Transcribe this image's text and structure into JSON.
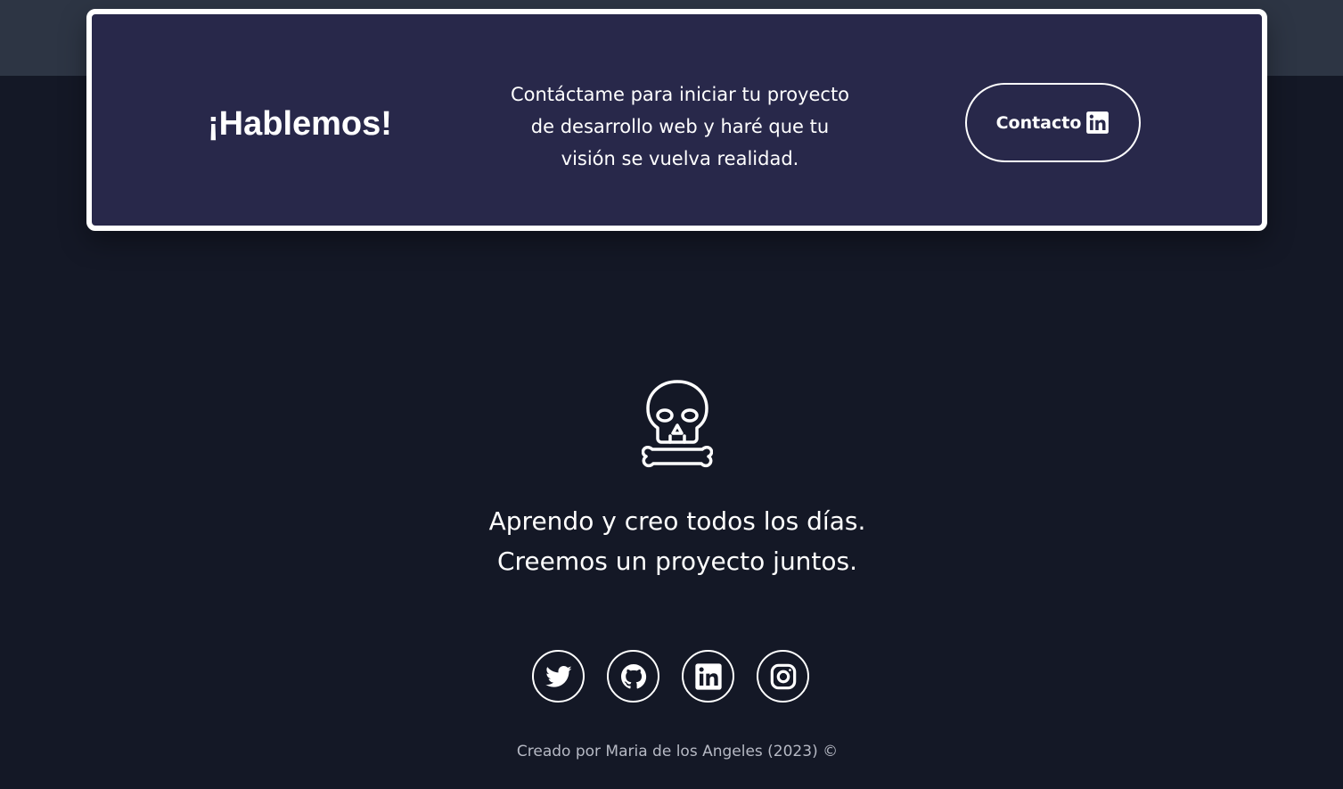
{
  "cta": {
    "title": "¡Hablemos!",
    "text_lines": [
      "Contáctame para iniciar tu proyecto",
      "de desarrollo web y haré que tu",
      "visión se vuelva realidad."
    ],
    "button_label": "Contacto",
    "button_icon": "linkedin-icon"
  },
  "hero": {
    "icon": "skull-crossbones-icon",
    "tagline_lines": [
      "Aprendo y creo todos los días.",
      "Creemos un proyecto juntos."
    ]
  },
  "socials": [
    "twitter-icon",
    "github-icon",
    "linkedin-icon",
    "instagram-icon"
  ],
  "footer": {
    "text": "Creado por Maria de los Angeles (2023) ©"
  },
  "colors": {
    "page_background": "#141826",
    "top_band": "#2d3544",
    "card_background": "#28284a",
    "text": "#ffffff",
    "footer_text": "#b6b9c4"
  }
}
